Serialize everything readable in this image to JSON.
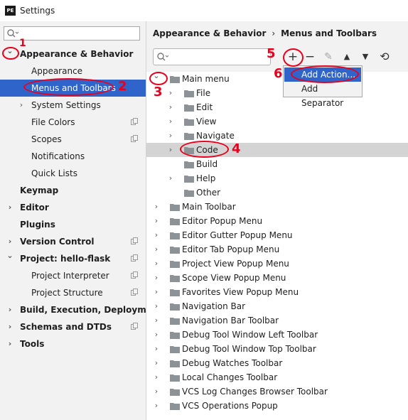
{
  "window": {
    "app_icon_text": "PE",
    "title": "Settings"
  },
  "sidebar": {
    "search_placeholder": "",
    "items": [
      {
        "label": "Appearance & Behavior",
        "bold": true,
        "expanded": true
      },
      {
        "label": "Appearance"
      },
      {
        "label": "Menus and Toolbars",
        "selected": true
      },
      {
        "label": "System Settings",
        "collapsed": true
      },
      {
        "label": "File Colors",
        "copy_icon": true
      },
      {
        "label": "Scopes",
        "copy_icon": true
      },
      {
        "label": "Notifications"
      },
      {
        "label": "Quick Lists"
      },
      {
        "label": "Keymap",
        "bold": true
      },
      {
        "label": "Editor",
        "bold": true,
        "collapsed": true
      },
      {
        "label": "Plugins",
        "bold": true
      },
      {
        "label": "Version Control",
        "bold": true,
        "collapsed": true,
        "copy_icon": true
      },
      {
        "label": "Project: hello-flask",
        "bold": true,
        "expanded": true,
        "copy_icon": true
      },
      {
        "label": "Project Interpreter",
        "copy_icon": true
      },
      {
        "label": "Project Structure",
        "copy_icon": true
      },
      {
        "label": "Build, Execution, Deployment",
        "bold": true,
        "collapsed": true
      },
      {
        "label": "Schemas and DTDs",
        "bold": true,
        "collapsed": true,
        "copy_icon": true
      },
      {
        "label": "Tools",
        "bold": true,
        "collapsed": true
      }
    ]
  },
  "breadcrumb": {
    "parent": "Appearance & Behavior",
    "separator": "›",
    "current": "Menus and Toolbars"
  },
  "filter": {
    "placeholder": ""
  },
  "toolbar": {
    "add": "+",
    "remove": "−",
    "edit": "✎",
    "move_up": "▲",
    "move_down": "▼",
    "restore": "⟲"
  },
  "popup": {
    "items": [
      "Add Action...",
      "Add Separator"
    ]
  },
  "tree": [
    {
      "label": "Main menu",
      "level": 0,
      "expanded": true
    },
    {
      "label": "File",
      "level": 1,
      "collapsed": true
    },
    {
      "label": "Edit",
      "level": 1,
      "collapsed": true
    },
    {
      "label": "View",
      "level": 1,
      "collapsed": true
    },
    {
      "label": "Navigate",
      "level": 1,
      "collapsed": true
    },
    {
      "label": "Code",
      "level": 1,
      "collapsed": true,
      "selected": true
    },
    {
      "label": "Build",
      "level": 1
    },
    {
      "label": "Help",
      "level": 1,
      "collapsed": true
    },
    {
      "label": "Other",
      "level": 1
    },
    {
      "label": "Main Toolbar",
      "level": 0,
      "collapsed": true
    },
    {
      "label": "Editor Popup Menu",
      "level": 0,
      "collapsed": true
    },
    {
      "label": "Editor Gutter Popup Menu",
      "level": 0,
      "collapsed": true
    },
    {
      "label": "Editor Tab Popup Menu",
      "level": 0,
      "collapsed": true
    },
    {
      "label": "Project View Popup Menu",
      "level": 0,
      "collapsed": true
    },
    {
      "label": "Scope View Popup Menu",
      "level": 0,
      "collapsed": true
    },
    {
      "label": "Favorites View Popup Menu",
      "level": 0,
      "collapsed": true
    },
    {
      "label": "Navigation Bar",
      "level": 0,
      "collapsed": true
    },
    {
      "label": "Navigation Bar Toolbar",
      "level": 0,
      "collapsed": true
    },
    {
      "label": "Debug Tool Window Left Toolbar",
      "level": 0,
      "collapsed": true
    },
    {
      "label": "Debug Tool Window Top Toolbar",
      "level": 0,
      "collapsed": true
    },
    {
      "label": "Debug Watches Toolbar",
      "level": 0,
      "collapsed": true
    },
    {
      "label": "Local Changes Toolbar",
      "level": 0,
      "collapsed": true
    },
    {
      "label": "VCS Log Changes Browser Toolbar",
      "level": 0,
      "collapsed": true
    },
    {
      "label": "VCS Operations Popup",
      "level": 0,
      "collapsed": true
    }
  ],
  "annotations": {
    "step1": "1",
    "step2": "2",
    "step3": "3",
    "step4": "4",
    "step5": "5",
    "step6": "6",
    "color": "#e8001c"
  },
  "colors": {
    "selection": "#2f65ca",
    "tree_selection": "#d4d4d4",
    "folder": "#8d9297"
  }
}
